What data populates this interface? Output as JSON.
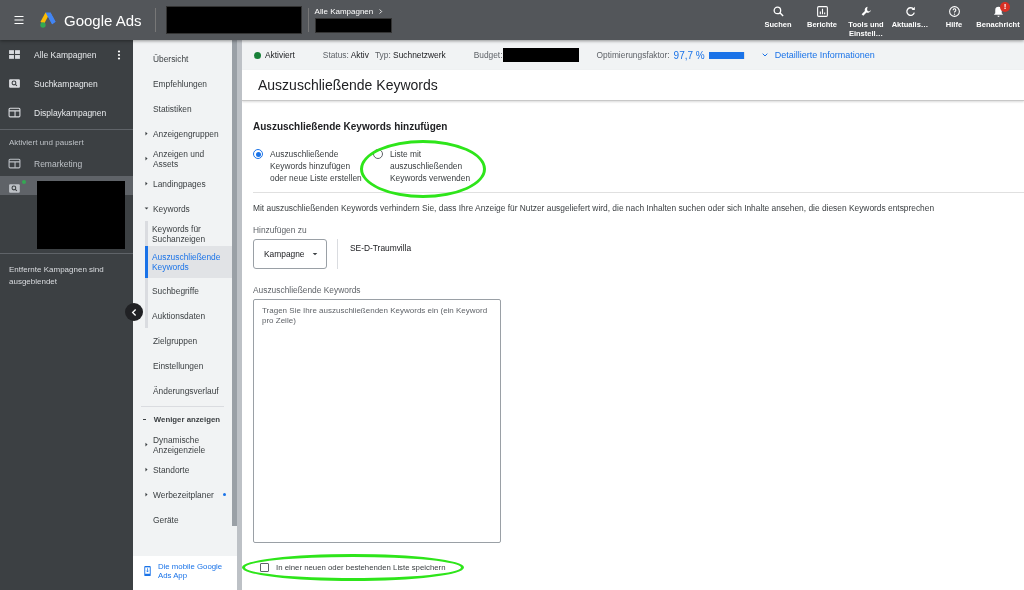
{
  "header": {
    "app_name": "Google Ads",
    "breadcrumb": "Alle Kampagnen",
    "actions": [
      {
        "kind": "search",
        "label": "Suchen"
      },
      {
        "kind": "reports",
        "label": "Berichte"
      },
      {
        "kind": "tools",
        "label": "Tools und Einstell…"
      },
      {
        "kind": "refresh",
        "label": "Aktualis…"
      },
      {
        "kind": "help",
        "label": "Hilfe"
      },
      {
        "kind": "notifications",
        "label": "Benachricht",
        "badge": "!"
      }
    ]
  },
  "campaign_sidebar": {
    "items": [
      {
        "kind": "all",
        "label": "Alle Kampagnen"
      },
      {
        "kind": "search",
        "label": "Suchkampagnen"
      },
      {
        "kind": "display",
        "label": "Displaykampagnen"
      }
    ],
    "section_label": "Aktiviert und pausiert",
    "campaigns": [
      {
        "kind": "display",
        "label": "Remarketing",
        "selected": false
      },
      {
        "kind": "search",
        "selected": true
      }
    ],
    "note": "Entfernte Kampagnen sind ausgeblendet"
  },
  "page_nav": {
    "items": [
      {
        "kind": "link",
        "label": "Übersicht",
        "selected": false
      },
      {
        "kind": "link",
        "label": "Empfehlungen",
        "selected": false
      },
      {
        "kind": "link",
        "label": "Statistiken",
        "selected": false
      },
      {
        "kind": "group",
        "label": "Anzeigengruppen",
        "expanded": false
      },
      {
        "kind": "group",
        "label": "Anzeigen und Assets",
        "expanded": false
      },
      {
        "kind": "group",
        "label": "Landingpages",
        "expanded": false
      },
      {
        "kind": "group",
        "label": "Keywords",
        "expanded": true,
        "children": [
          {
            "kind": "link",
            "label": "Keywords für Suchanzeigen",
            "selected": false
          },
          {
            "kind": "link",
            "label": "Auszuschließende Keywords",
            "selected": true
          },
          {
            "kind": "link",
            "label": "Suchbegriffe",
            "selected": false
          },
          {
            "kind": "link",
            "label": "Auktionsdaten",
            "selected": false
          }
        ]
      },
      {
        "kind": "link",
        "label": "Zielgruppen",
        "selected": false
      },
      {
        "kind": "link",
        "label": "Einstellungen",
        "selected": false
      },
      {
        "kind": "link",
        "label": "Änderungsverlauf",
        "selected": false
      },
      {
        "kind": "toggle",
        "label": "Weniger anzeigen"
      },
      {
        "kind": "group",
        "label": "Dynamische Anzeigenziele",
        "expanded": false
      },
      {
        "kind": "group",
        "label": "Standorte",
        "expanded": false
      },
      {
        "kind": "group",
        "label": "Werbezeitplaner",
        "expanded": false,
        "dot": true
      },
      {
        "kind": "link",
        "label": "Geräte",
        "selected": false
      }
    ],
    "app_promo": "Die mobile Google Ads App"
  },
  "summary_bar": {
    "status": "Aktiviert",
    "status_label": "Status:",
    "status_value": "Aktiv",
    "type_label": "Typ:",
    "type_value": "Suchnetzwerk",
    "budget_label": "Budget:",
    "optimization_label": "Optimierungsfaktor:",
    "optimization_value": "97,7 %",
    "level": 0.977,
    "details_link": "Detaillierte Informationen"
  },
  "page_title": "Auszuschließende Keywords",
  "form": {
    "heading": "Auszuschließende Keywords hinzufügen",
    "options": [
      {
        "label": "Auszuschließende Keywords hinzufügen oder neue Liste erstellen",
        "selected": true
      },
      {
        "label": "Liste mit auszuschließenden Keywords verwenden",
        "selected": false
      }
    ],
    "description": "Mit auszuschließenden Keywords verhindern Sie, dass Ihre Anzeige für Nutzer ausgeliefert wird, die nach Inhalten suchen oder sich Inhalte ansehen, die diesen Keywords entsprechen",
    "add_to_label": "Hinzufügen zu",
    "add_to_value": "Kampagne",
    "campaign_name": "SE-D-Traumvilla",
    "keywords_label": "Auszuschließende Keywords",
    "keywords_placeholder": "Tragen Sie Ihre auszuschließenden Keywords ein (ein Keyword pro Zeile)",
    "save_list": {
      "label": "In einer neuen oder bestehenden Liste speichern",
      "checked": false
    }
  }
}
